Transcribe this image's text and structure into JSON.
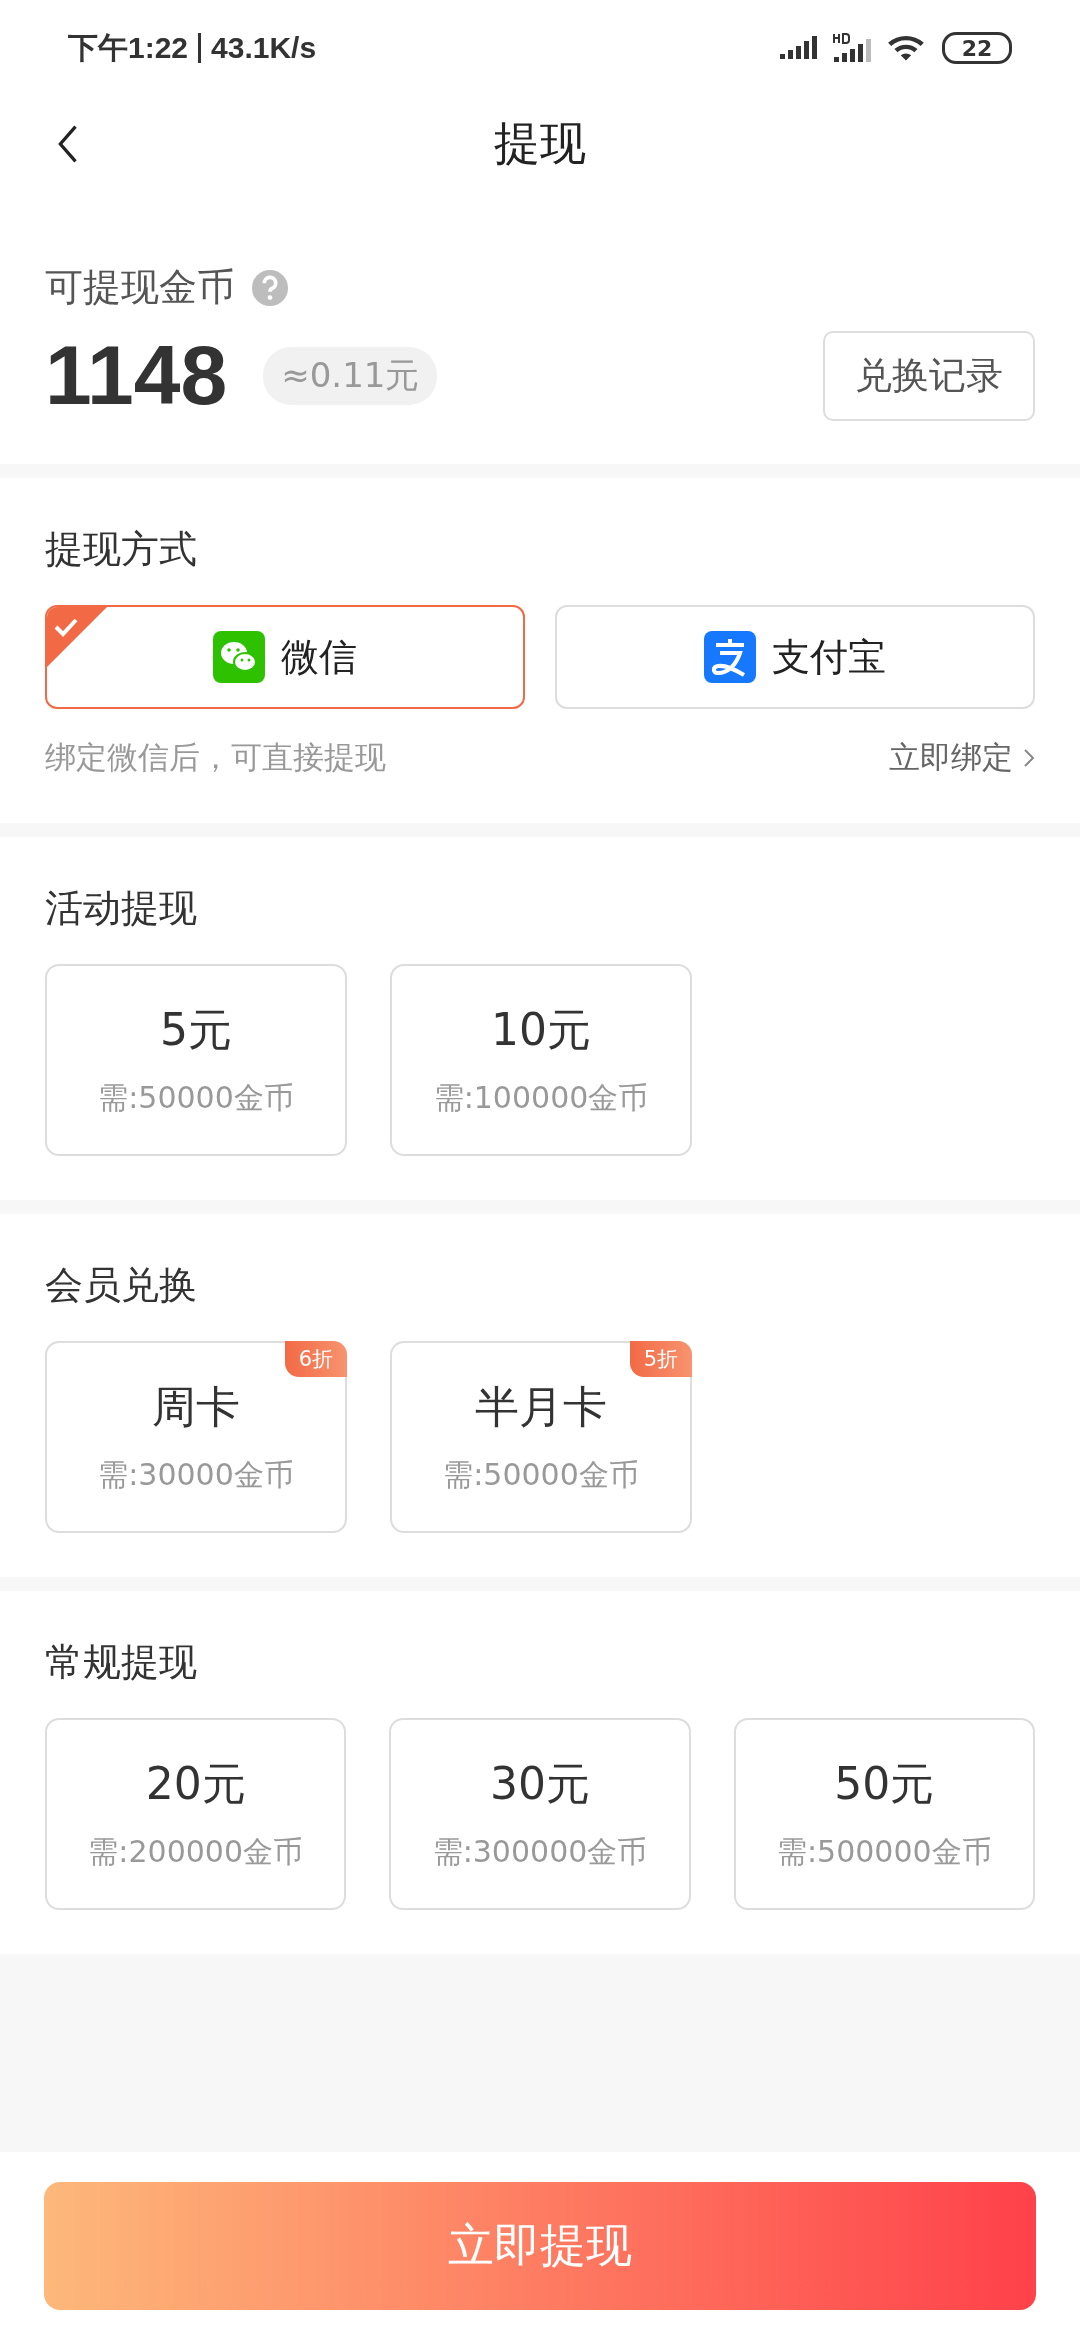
{
  "status_bar": {
    "time": "下午1:22",
    "speed": "43.1K/s",
    "battery": "22"
  },
  "header": {
    "title": "提现"
  },
  "balance": {
    "label": "可提现金币",
    "amount": "1148",
    "approx": "≈0.11元",
    "history_button": "兑换记录"
  },
  "methods": {
    "title": "提现方式",
    "options": [
      {
        "kind": "wechat",
        "label": "微信",
        "selected": true
      },
      {
        "kind": "alipay",
        "label": "支付宝",
        "selected": false
      }
    ],
    "hint": "绑定微信后，可直接提现",
    "bind_link": "立即绑定"
  },
  "sections": [
    {
      "title": "活动提现",
      "cards": [
        {
          "name": "5元",
          "cost": "需:50000金币"
        },
        {
          "name": "10元",
          "cost": "需:100000金币"
        }
      ]
    },
    {
      "title": "会员兑换",
      "cards": [
        {
          "name": "周卡",
          "cost": "需:30000金币",
          "badge": "6折"
        },
        {
          "name": "半月卡",
          "cost": "需:50000金币",
          "badge": "5折"
        }
      ]
    },
    {
      "title": "常规提现",
      "cards": [
        {
          "name": "20元",
          "cost": "需:200000金币"
        },
        {
          "name": "30元",
          "cost": "需:300000金币"
        },
        {
          "name": "50元",
          "cost": "需:500000金币"
        }
      ]
    }
  ],
  "submit_button": "立即提现"
}
